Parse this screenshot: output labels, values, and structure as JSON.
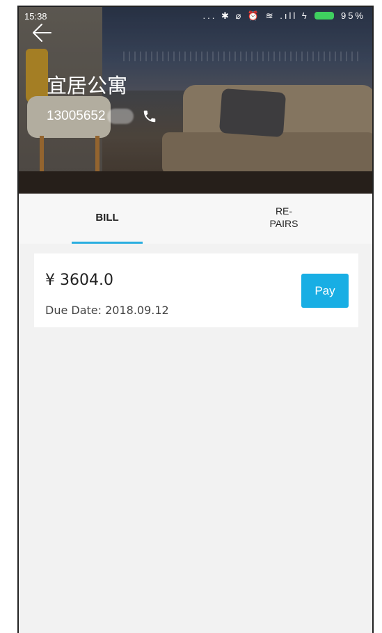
{
  "status_bar": {
    "time": "15:38",
    "icons_text": "... ✱ ⌀ ⏰ ≋ .ıll ϟ",
    "battery_percent": "95%"
  },
  "header": {
    "title": "宜居公寓",
    "phone_prefix": "13005652",
    "back_icon": "arrow-left-icon",
    "phone_icon": "phone-icon"
  },
  "tabs": [
    {
      "label": "BILL",
      "active": true
    },
    {
      "label": "RE-\nPAIRS",
      "active": false
    }
  ],
  "bill": {
    "amount": "¥ 3604.0",
    "due_date": "Due Date: 2018.09.12",
    "pay_label": "Pay"
  },
  "colors": {
    "accent": "#29aee0",
    "pay_button": "#18aee4",
    "background": "#f2f2f2"
  }
}
